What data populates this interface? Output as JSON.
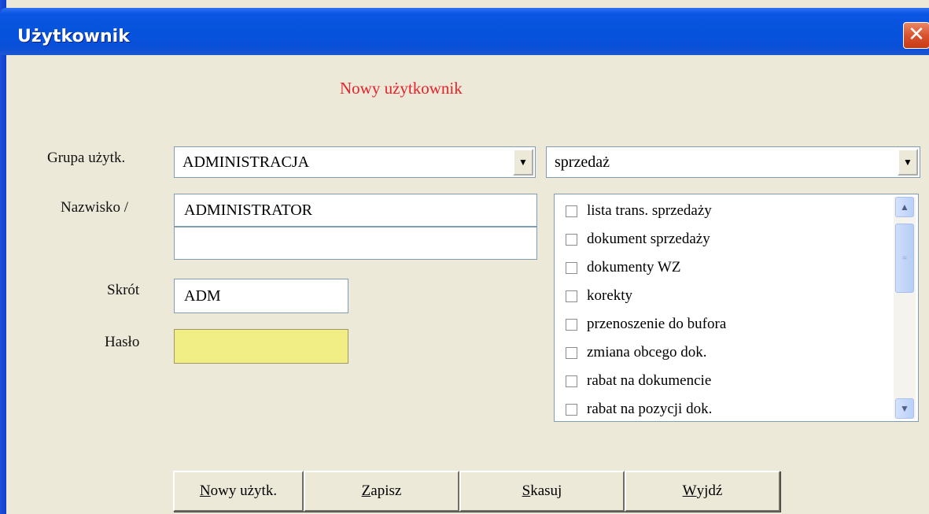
{
  "window": {
    "title": "Użytkownik",
    "close_symbol": "✕"
  },
  "heading": "Nowy użytkownik",
  "group": {
    "label": "Grupa użytk.",
    "value": "ADMINISTRACJA"
  },
  "module_select": {
    "value": "sprzedaż"
  },
  "surname": {
    "label": "Nazwisko /",
    "value": "ADMINISTRATOR",
    "value2": ""
  },
  "abbrev": {
    "label": "Skrót",
    "value": "ADM"
  },
  "password": {
    "label": "Hasło",
    "value": ""
  },
  "permissions": [
    {
      "label": "lista trans. sprzedaży",
      "checked": false
    },
    {
      "label": "dokument sprzedaży",
      "checked": false
    },
    {
      "label": "dokumenty WZ",
      "checked": false
    },
    {
      "label": "korekty",
      "checked": false
    },
    {
      "label": "przenoszenie do bufora",
      "checked": false
    },
    {
      "label": "zmiana obcego dok.",
      "checked": false
    },
    {
      "label": "rabat na dokumencie",
      "checked": false
    },
    {
      "label": "rabat na pozycji dok.",
      "checked": false
    }
  ],
  "buttons": {
    "new_user": {
      "ul": "N",
      "rest": "owy użytk."
    },
    "save": {
      "ul": "Z",
      "rest": "apisz"
    },
    "delete": {
      "ul": "S",
      "rest": "kasuj"
    },
    "exit": {
      "ul": "W",
      "rest": "yjdź"
    }
  },
  "icons": {
    "dropdown": "chevron-down-icon",
    "close": "close-icon",
    "scroll_up": "scroll-up-icon",
    "scroll_down": "scroll-down-icon"
  }
}
